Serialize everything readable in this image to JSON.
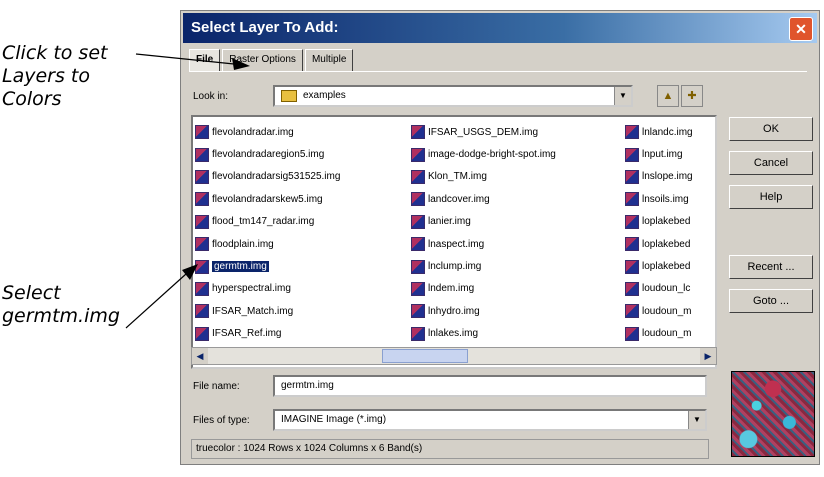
{
  "callouts": {
    "set_layers": "Click to set\nLayers to\nColors",
    "select_file": "Select\ngermtm.img"
  },
  "dialog": {
    "title": "Select Layer To Add:",
    "close_glyph": "✕",
    "tabs": [
      "File",
      "Raster Options",
      "Multiple"
    ],
    "look_in_label": "Look in:",
    "look_in_value": "examples",
    "files": {
      "col1": [
        "flevolandradar.img",
        "flevolandradaregion5.img",
        "flevolandradarsig531525.img",
        "flevolandradarskew5.img",
        "flood_tm147_radar.img",
        "floodplain.img",
        "germtm.img",
        "hyperspectral.img",
        "IFSAR_Match.img",
        "IFSAR_Ref.img"
      ],
      "col2": [
        "IFSAR_USGS_DEM.img",
        "image-dodge-bright-spot.img",
        "Klon_TM.img",
        "landcover.img",
        "lanier.img",
        "lnaspect.img",
        "lnclump.img",
        "lndem.img",
        "lnhydro.img",
        "lnlakes.img"
      ],
      "col3": [
        "lnlandc.img",
        "lnput.img",
        "lnslope.img",
        "lnsoils.img",
        "loplakebed",
        "loplakebed",
        "loplakebed",
        "loudoun_lc",
        "loudoun_m",
        "loudoun_m"
      ]
    },
    "selected_file": "germtm.img",
    "file_name_label": "File name:",
    "file_name_value": "germtm.img",
    "files_of_type_label": "Files of type:",
    "files_of_type_value": "IMAGINE Image (*.img)",
    "status": "truecolor : 1024 Rows x 1024 Columns x 6 Band(s)",
    "buttons": {
      "ok": "OK",
      "cancel": "Cancel",
      "help": "Help",
      "recent": "Recent ...",
      "goto": "Goto ..."
    }
  }
}
